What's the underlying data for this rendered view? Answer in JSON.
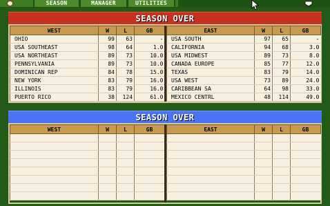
{
  "menu": {
    "items": [
      "SEASON",
      "MANAGER",
      "UTILITIES"
    ]
  },
  "icons": [
    "baseball-icon",
    "mouse-cursor-icon",
    "baseball-icon"
  ],
  "panel1": {
    "title": "SEASON OVER",
    "west": {
      "headers": [
        "WEST",
        "W",
        "L",
        "GB"
      ],
      "rows": [
        [
          "OHIO",
          "99",
          "63",
          "-"
        ],
        [
          "USA SOUTHEAST",
          "98",
          "64",
          "1.0"
        ],
        [
          "USA NORTHEAST",
          "89",
          "73",
          "10.0"
        ],
        [
          "PENNSYLVANIA",
          "89",
          "73",
          "10.0"
        ],
        [
          "DOMINICAN REP",
          "84",
          "78",
          "15.0"
        ],
        [
          "NEW YORK",
          "83",
          "79",
          "16.0"
        ],
        [
          "ILLINOIS",
          "83",
          "79",
          "16.0"
        ],
        [
          "PUERTO RICO",
          "38",
          "124",
          "61.0"
        ]
      ]
    },
    "east": {
      "headers": [
        "EAST",
        "W",
        "L",
        "GB"
      ],
      "rows": [
        [
          "USA SOUTH",
          "97",
          "65",
          "-"
        ],
        [
          "CALIFORNIA",
          "94",
          "68",
          "3.0"
        ],
        [
          "USA MIDWEST",
          "89",
          "73",
          "8.0"
        ],
        [
          "CANADA EUROPE",
          "85",
          "77",
          "12.0"
        ],
        [
          "TEXAS",
          "83",
          "79",
          "14.0"
        ],
        [
          "USA WEST",
          "73",
          "89",
          "24.0"
        ],
        [
          "CARIBBEAN SA",
          "64",
          "98",
          "33.0"
        ],
        [
          "MEXICO CENTRL",
          "48",
          "114",
          "49.0"
        ]
      ]
    }
  },
  "panel2": {
    "title": "SEASON OVER",
    "west": {
      "headers": [
        "WEST",
        "W",
        "L",
        "GB"
      ]
    },
    "east": {
      "headers": [
        "EAST",
        "W",
        "L",
        "GB"
      ]
    }
  },
  "colors": {
    "background": "#245a18",
    "title_red": "#c8301f",
    "title_blue": "#4a74f2",
    "header": "#c89a50",
    "table_bg": "#f7efe0"
  }
}
